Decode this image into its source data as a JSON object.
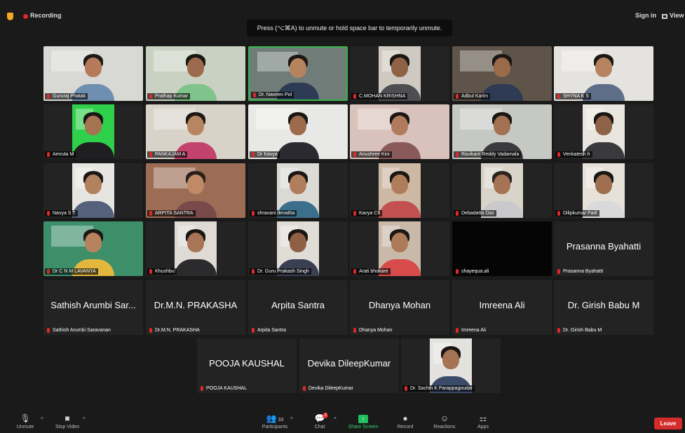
{
  "topbar": {
    "recording_label": "Recording",
    "signin_label": "Sign in",
    "view_label": "View"
  },
  "banner": {
    "text": "Press (⌥⌘A) to unmute or hold space bar to temporarily unmute."
  },
  "rows": [
    [
      {
        "label": "Gururaj Phatak",
        "video": true,
        "bg": "#d8d8d4",
        "skin": "#b57a5a",
        "hair": "#1d1a18",
        "shirt": "#6f8fb0"
      },
      {
        "label": "Prathap Kumar",
        "video": true,
        "bg": "#c9d2c2",
        "skin": "#9c6a4c",
        "hair": "#1a1614",
        "shirt": "#7ec48b"
      },
      {
        "label": "Dr. Naveen Pol",
        "video": true,
        "active": true,
        "bg": "#6f7c78",
        "skin": "#b5845e",
        "hair": "#1b1715",
        "shirt": "#2d3b55"
      },
      {
        "label": "C.MOHAN KRISHNA",
        "video": true,
        "narrow": true,
        "bg": "#cfcac1",
        "skin": "#8f6246",
        "hair": "#1a1614",
        "shirt": "#4e4e52"
      },
      {
        "label": "Adbul Karim",
        "video": true,
        "bg": "#5f5449",
        "skin": "#9a6a4b",
        "hair": "#1a1614",
        "shirt": "#2f3b52"
      },
      {
        "label": "SHYNA K S",
        "video": true,
        "bg": "#e5e3df",
        "skin": "#b78462",
        "hair": "#1c1816",
        "shirt": "#5e6e88"
      }
    ],
    [
      {
        "label": "Amruta M",
        "video": true,
        "narrow": true,
        "bg": "#2fd04a",
        "skin": "#a67453",
        "hair": "#1a1614",
        "shirt": "#1f1f22"
      },
      {
        "label": "PANKAJAM A",
        "video": true,
        "bg": "#d8d2c8",
        "skin": "#b78560",
        "hair": "#1b1715",
        "shirt": "#c2436e"
      },
      {
        "label": "Dr Kavya",
        "video": true,
        "bg": "#e8e8e6",
        "skin": "#9d6b4c",
        "hair": "#1a1614",
        "shirt": "#2a2a30"
      },
      {
        "label": "Anushree Kini",
        "video": true,
        "bg": "#d9c2bb",
        "skin": "#b07b5b",
        "hair": "#1d1816",
        "shirt": "#8a5a5a"
      },
      {
        "label": "Ravikant Reddy Vadamala",
        "video": true,
        "bg": "#c6c8c4",
        "skin": "#a47253",
        "hair": "#1a1614",
        "shirt": "#3b3b3e"
      },
      {
        "label": "Venkatesh h",
        "video": true,
        "narrow": true,
        "bg": "#e9e6df",
        "skin": "#8e6247",
        "hair": "#1a1614",
        "shirt": "#3a3a3d"
      }
    ],
    [
      {
        "label": "Navya S T",
        "video": true,
        "narrow": true,
        "bg": "#e7e5e1",
        "skin": "#b28160",
        "hair": "#1b1715",
        "shirt": "#55607a"
      },
      {
        "label": "ARPITA SANTRA",
        "video": true,
        "bg": "#9d6c55",
        "skin": "#c08a66",
        "hair": "#2a1f1a",
        "shirt": "#7a4a4a"
      },
      {
        "label": "shravani devatha",
        "video": true,
        "narrow": true,
        "bg": "#dcdad5",
        "skin": "#b07e5c",
        "hair": "#1a1614",
        "shirt": "#3c6f8c"
      },
      {
        "label": "Kavya Ch",
        "video": true,
        "narrow": true,
        "bg": "#cdb8a4",
        "skin": "#b07d5b",
        "hair": "#1b1715",
        "shirt": "#c25050"
      },
      {
        "label": "Debadatta Das",
        "video": true,
        "narrow": true,
        "bg": "#d9d4ca",
        "skin": "#a67454",
        "hair": "#2a2420",
        "shirt": "#c9c9cc"
      },
      {
        "label": "Dilipkumar Patil",
        "video": true,
        "narrow": true,
        "bg": "#e6e2da",
        "skin": "#a06f50",
        "hair": "#1a1614",
        "shirt": "#d9d9dc"
      }
    ],
    [
      {
        "label": "Dr C N M LAVANYA",
        "video": true,
        "bg": "#3d8f6a",
        "skin": "#b7835f",
        "hair": "#1c1816",
        "shirt": "#e3b73d"
      },
      {
        "label": "Khushbu",
        "video": true,
        "narrow": true,
        "bg": "#dedbd4",
        "skin": "#a87657",
        "hair": "#1a1614",
        "shirt": "#2b2b2e"
      },
      {
        "label": "Dr. Guru Prakash Singh",
        "video": true,
        "narrow": true,
        "bg": "#e0ddd7",
        "skin": "#8f6045",
        "hair": "#1a1614",
        "shirt": "#3b3f52"
      },
      {
        "label": "Arati bhokare",
        "video": true,
        "narrow": true,
        "bg": "#c8b9a8",
        "skin": "#ad7b59",
        "hair": "#1b1715",
        "shirt": "#d84b4b"
      },
      {
        "label": "shayequa.ali",
        "black": true
      },
      {
        "label": "Prasanna Byahatti",
        "bigname": "Prasanna Byahatti"
      }
    ],
    [
      {
        "label": "Sathish Arumbi Saravanan",
        "bigname": "Sathish Arumbi Sar..."
      },
      {
        "label": "Dr.M.N. PRAKASHA",
        "bigname": "Dr.M.N. PRAKASHA"
      },
      {
        "label": "Arpita Santra",
        "bigname": "Arpita Santra"
      },
      {
        "label": "Dhanya Mohan",
        "bigname": "Dhanya Mohan"
      },
      {
        "label": "Imreena Ali",
        "bigname": "Imreena Ali"
      },
      {
        "label": "Dr. Girish Babu M",
        "bigname": "Dr. Girish Babu M"
      }
    ],
    [
      {
        "label": "POOJA KAUSHAL",
        "bigname": "POOJA KAUSHAL"
      },
      {
        "label": "Devika DileepKumar",
        "bigname": "Devika DileepKumar"
      },
      {
        "label": "Dr. Sachin K Parappagoudar",
        "video": true,
        "narrow": true,
        "bg": "#e4e2de",
        "skin": "#a57354",
        "hair": "#1a1614",
        "shirt": "#3c4a6a"
      }
    ]
  ],
  "toolbar": {
    "unmute": {
      "label": "Unmute",
      "icon": "mic-muted-icon"
    },
    "stop_video": {
      "label": "Stop Video",
      "icon": "video-camera-icon"
    },
    "participants": {
      "label": "Participants",
      "count": "33",
      "icon": "participants-icon"
    },
    "chat": {
      "label": "Chat",
      "badge": "2",
      "icon": "chat-icon"
    },
    "share_screen": {
      "label": "Share Screen",
      "icon": "share-screen-icon"
    },
    "record": {
      "label": "Record",
      "icon": "record-icon"
    },
    "reactions": {
      "label": "Reactions",
      "icon": "reactions-icon"
    },
    "apps": {
      "label": "Apps",
      "icon": "apps-icon"
    },
    "leave": {
      "label": "Leave"
    }
  },
  "colors": {
    "accent_green": "#3ab54a",
    "leave_red": "#d42b2b",
    "muted_red": "#e02828"
  }
}
